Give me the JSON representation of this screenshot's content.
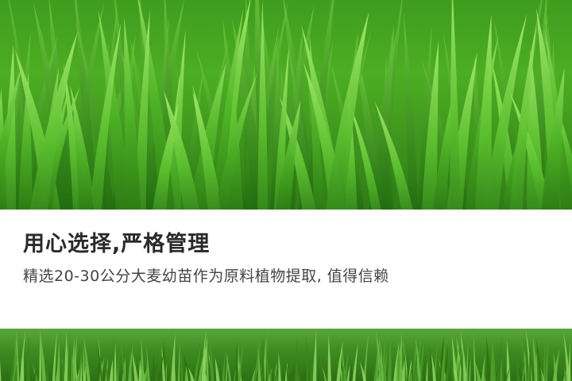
{
  "headline": "用心选择,严格管理",
  "subline": "精选20-30公分大麦幼苗作为原料植物提取, 值得信赖",
  "colors": {
    "grass_light": "#7ed34a",
    "grass_mid": "#4cae22",
    "grass_dark": "#2f7a16",
    "text_dark": "#2a2a2a",
    "text_sub": "#444444"
  },
  "images": {
    "top": "tall-grass-closeup-photo",
    "bottom": "lawn-grass-photo"
  }
}
